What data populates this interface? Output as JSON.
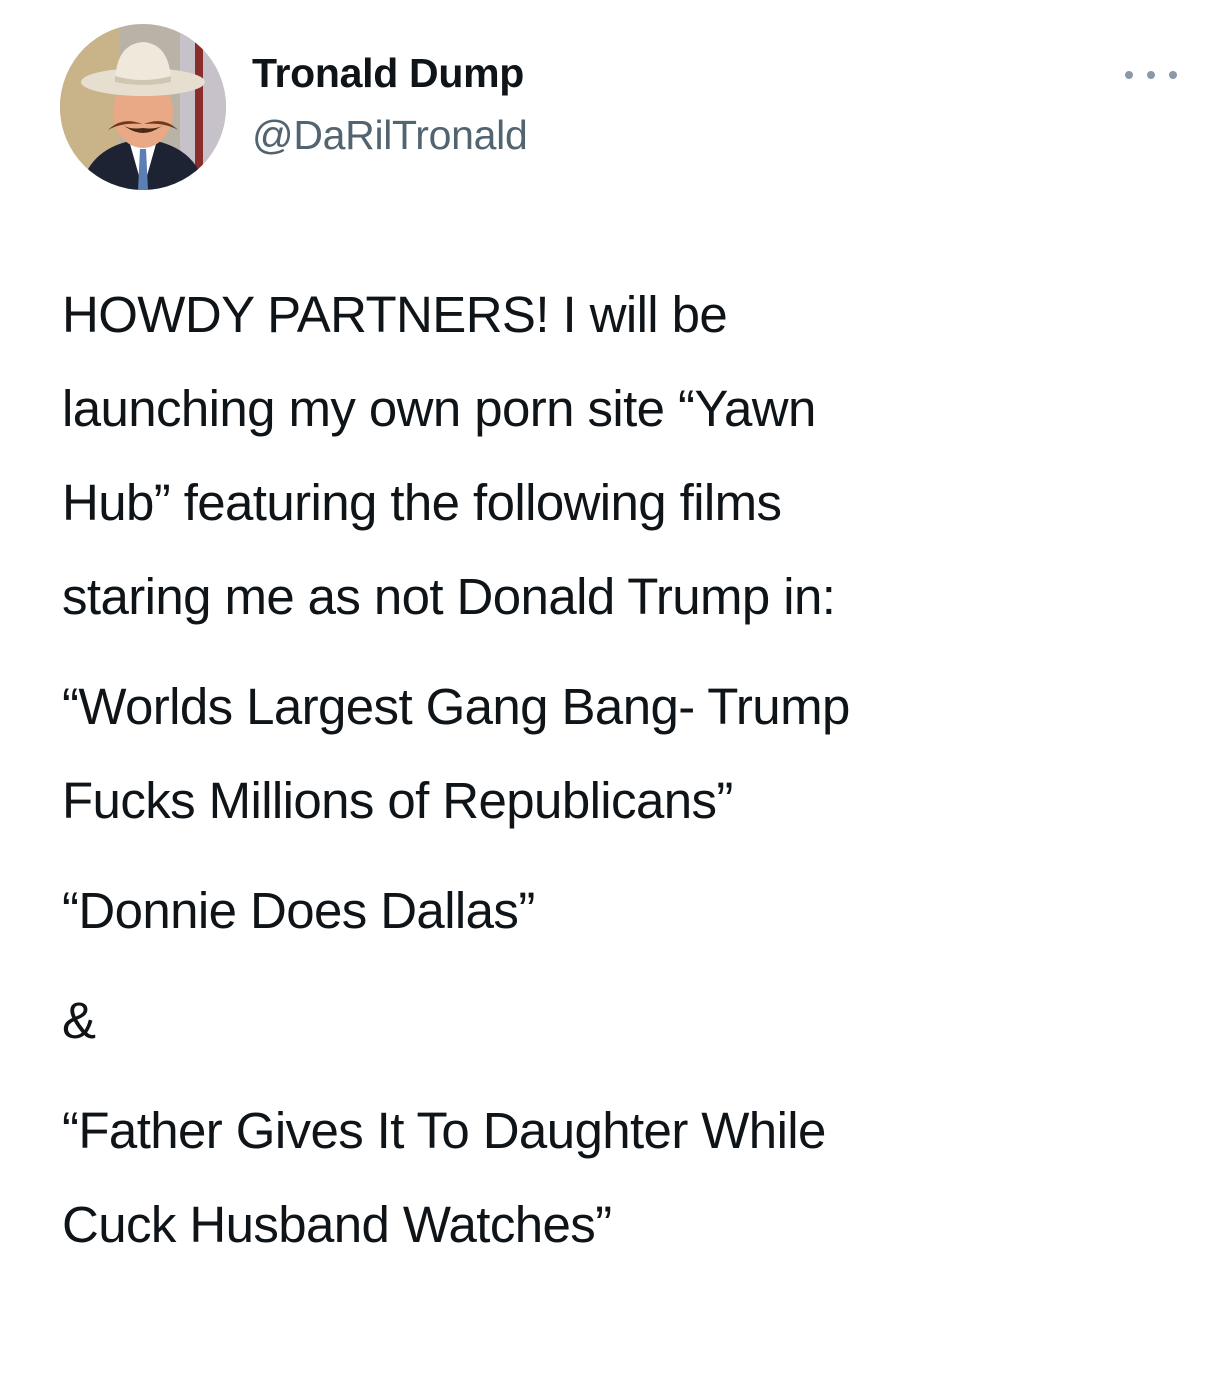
{
  "user": {
    "display_name": "Tronald Dump",
    "handle": "@DaRilTronald",
    "avatar_icon": "profile-photo-cowboy-hat"
  },
  "menu": {
    "icon": "more-horizontal-icon"
  },
  "tweet": {
    "paragraphs": [
      "HOWDY PARTNERS! I will be\nlaunching my own porn site “Yawn\nHub” featuring the following films\nstaring me as not Donald Trump in:",
      "“Worlds Largest Gang Bang- Trump\nFucks Millions of Republicans”",
      "“Donnie Does Dallas”",
      "&",
      "“Father Gives It To Daughter While\nCuck Husband Watches”"
    ]
  },
  "colors": {
    "text": "#0f1419",
    "secondary": "#536471",
    "icon": "#8b98a5",
    "background": "#ffffff"
  }
}
